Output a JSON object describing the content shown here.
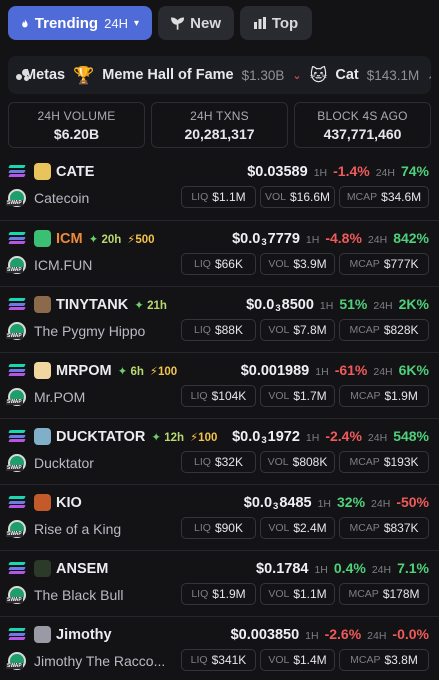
{
  "tabs": [
    {
      "label": "Trending",
      "suffix": "24H",
      "icon": "fire-icon"
    },
    {
      "label": "New",
      "icon": "sprout-icon"
    },
    {
      "label": "Top",
      "icon": "bar-chart-icon"
    }
  ],
  "metas": [
    {
      "label": "Metas",
      "icon": "metas-icon",
      "value": ""
    },
    {
      "label": "Meme Hall of Fame",
      "icon": "trophy-icon",
      "emoji": "🏆",
      "value": "$1.30B",
      "trend": "down"
    },
    {
      "label": "Cat",
      "icon": "cat-icon",
      "emoji": "🐱",
      "value": "$143.1M"
    }
  ],
  "stats": [
    {
      "label": "24H VOLUME",
      "value": "$6.20B"
    },
    {
      "label": "24H TXNS",
      "value": "20,281,317"
    },
    {
      "label": "BLOCK 4S AGO",
      "value": "437,771,460"
    }
  ],
  "labels": {
    "h1": "1H",
    "h24": "24H",
    "liq": "LIQ",
    "vol": "VOL",
    "mcap": "MCAP"
  },
  "tokens": [
    {
      "symbol": "CATE",
      "name": "Catecoin",
      "price": "$0.03589",
      "price_zeros": "",
      "price_tail": "",
      "h1": "-1.4%",
      "h24": "74%",
      "liq": "$1.1M",
      "vol": "$16.6M",
      "mcap": "$34.6M",
      "logo_color": "#e9c35b"
    },
    {
      "symbol": "ICM",
      "name": "ICM.FUN",
      "age": "20h",
      "boost": "500",
      "price": "$0.0",
      "price_zeros": "3",
      "price_tail": "7779",
      "h1": "-4.8%",
      "h24": "842%",
      "liq": "$66K",
      "vol": "$3.9M",
      "mcap": "$777K",
      "logo_color": "#3bbf72"
    },
    {
      "symbol": "TINYTANK",
      "name": "The Pygmy Hippo",
      "age": "21h",
      "boost": "",
      "price": "$0.0",
      "price_zeros": "3",
      "price_tail": "8500",
      "h1": "51%",
      "h24": "2K%",
      "liq": "$88K",
      "vol": "$7.8M",
      "mcap": "$828K",
      "logo_color": "#8a6a4a"
    },
    {
      "symbol": "MRPOM",
      "name": "Mr.POM",
      "age": "6h",
      "boost": "100",
      "price": "$0.001989",
      "price_zeros": "",
      "price_tail": "",
      "h1": "-61%",
      "h24": "6K%",
      "liq": "$104K",
      "vol": "$1.7M",
      "mcap": "$1.9M",
      "logo_color": "#f2d6a0"
    },
    {
      "symbol": "DUCKTATOR",
      "name": "Ducktator",
      "age": "12h",
      "boost": "100",
      "price": "$0.0",
      "price_zeros": "3",
      "price_tail": "1972",
      "h1": "-2.4%",
      "h24": "548%",
      "liq": "$32K",
      "vol": "$808K",
      "mcap": "$193K",
      "logo_color": "#7fb0c8"
    },
    {
      "symbol": "KIO",
      "name": "Rise of a King",
      "age": "",
      "boost": "",
      "price": "$0.0",
      "price_zeros": "3",
      "price_tail": "8485",
      "h1": "32%",
      "h24": "-50%",
      "liq": "$90K",
      "vol": "$2.4M",
      "mcap": "$837K",
      "logo_color": "#c45a2a"
    },
    {
      "symbol": "ANSEM",
      "name": "The Black Bull",
      "age": "",
      "boost": "",
      "price": "$0.1784",
      "price_zeros": "",
      "price_tail": "",
      "h1": "0.4%",
      "h24": "7.1%",
      "liq": "$1.9M",
      "vol": "$1.1M",
      "mcap": "$178M",
      "logo_color": "#2c3a2a"
    },
    {
      "symbol": "Jimothy",
      "name": "Jimothy The Racco...",
      "age": "",
      "boost": "",
      "price": "$0.003850",
      "price_zeros": "",
      "price_tail": "",
      "h1": "-2.6%",
      "h24": "-0.0%",
      "liq": "$341K",
      "vol": "$1.4M",
      "mcap": "$3.8M",
      "logo_color": "#9a9aa6"
    }
  ]
}
